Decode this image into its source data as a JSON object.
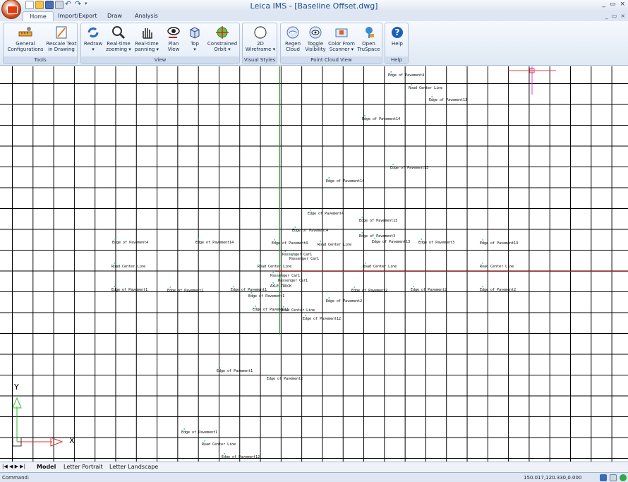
{
  "window": {
    "title": "Leica IMS  - [Baseline Offset.dwg]",
    "min": "_",
    "max": "▭",
    "close": "×",
    "doc_min": "_",
    "doc_max": "▭",
    "doc_close": "×"
  },
  "tabs": [
    "Home",
    "Import/Export",
    "Draw",
    "Analysis"
  ],
  "groups": {
    "tools": "Tools",
    "view": "View",
    "visual_styles": "Visual Styles",
    "point_cloud_view": "Point Cloud View",
    "help": "Help"
  },
  "buttons": {
    "general_config": [
      "General",
      "Configurations"
    ],
    "rescale_text": [
      "Rescale Text",
      "in Drawing"
    ],
    "redraw": [
      "Redraw",
      "▾"
    ],
    "realtime_zoom": [
      "Real-time",
      "zooming ▾"
    ],
    "realtime_pan": [
      "Real-time",
      "panning ▾"
    ],
    "plan_view": [
      "Plan",
      "View"
    ],
    "top": [
      "Top",
      "▾"
    ],
    "constrained_orbit": [
      "Constrained",
      "Orbit ▾"
    ],
    "wireframe": [
      "2D",
      "Wireframe ▾"
    ],
    "regen_cloud": [
      "Regen",
      "Cloud"
    ],
    "toggle_visibility": [
      "Toggle",
      "Visibility"
    ],
    "color_from_scanner": [
      "Color From",
      "Scanner ▾"
    ],
    "open_truspace": [
      "Open",
      "TruSpace"
    ],
    "help": [
      "Help",
      ""
    ]
  },
  "drawing_labels": [
    [
      "Edge of Pavement4",
      550,
      10
    ],
    [
      "Road Center Line",
      579,
      28
    ],
    [
      "Edge of Pavement13",
      608,
      45
    ],
    [
      "Edge of Pavement14",
      513,
      72
    ],
    [
      "Edge of Pavement13",
      553,
      141
    ],
    [
      "Edge of Pavement14",
      462,
      160
    ],
    [
      "Edge of Pavement4",
      436,
      206
    ],
    [
      "Edge of Pavement13",
      509,
      216
    ],
    [
      "Edge of Pavement4",
      414,
      230
    ],
    [
      "Edge of Pavement3",
      509,
      238
    ],
    [
      "Edge of Pavement4",
      159,
      247
    ],
    [
      "Edge of Pavement14",
      277,
      247
    ],
    [
      "Edge of Pavement4",
      385,
      248
    ],
    [
      "Road Center Line",
      450,
      250
    ],
    [
      "Edge of Pavement13",
      527,
      246
    ],
    [
      "Edge of Pavement3",
      593,
      247
    ],
    [
      "Edge of Pavement13",
      680,
      248
    ],
    [
      "Passenger Car1",
      400,
      264
    ],
    [
      "Passenger Car1",
      410,
      270
    ],
    [
      "Road Center Line",
      158,
      281
    ],
    [
      "Road Center Line",
      365,
      281
    ],
    [
      "Road Center Line",
      514,
      281
    ],
    [
      "Road Center Line",
      680,
      281
    ],
    [
      "Passenger Car1",
      383,
      294
    ],
    [
      "Passenger Car1",
      394,
      301
    ],
    [
      "AXLE TRUCK",
      383,
      309
    ],
    [
      "Edge of Pavement1",
      158,
      314
    ],
    [
      "Edge of Pavement1",
      237,
      315
    ],
    [
      "Edge of Pavement1",
      327,
      314
    ],
    [
      "Edge of Pavement2",
      498,
      315
    ],
    [
      "Edge of Pavement2",
      582,
      314
    ],
    [
      "Edge of Pavement2",
      680,
      314
    ],
    [
      "Edge of Pavement1",
      352,
      323
    ],
    [
      "Edge of Pavement2",
      462,
      330
    ],
    [
      "Edge of Pavement1",
      358,
      342
    ],
    [
      "Road Center Line",
      398,
      343
    ],
    [
      "Edge of Pavement12",
      429,
      355
    ],
    [
      "Edge of Pavement1",
      307,
      429
    ],
    [
      "Edge of Pavement2",
      378,
      440
    ],
    [
      "Edge of Pavement1",
      257,
      516
    ],
    [
      "Road Center Line",
      286,
      533
    ],
    [
      "Edge of Pavement12",
      314,
      551
    ]
  ],
  "canvas_texts": {
    "ucs_y": "Y",
    "ucs_x": "X"
  },
  "layout_tabs": [
    "Model",
    "Letter Portrait",
    "Letter Landscape"
  ],
  "nav": "|◀ ◀ ▶ ▶|",
  "status": {
    "command": "Command:",
    "coords": "150.017,120.330,0.000"
  }
}
